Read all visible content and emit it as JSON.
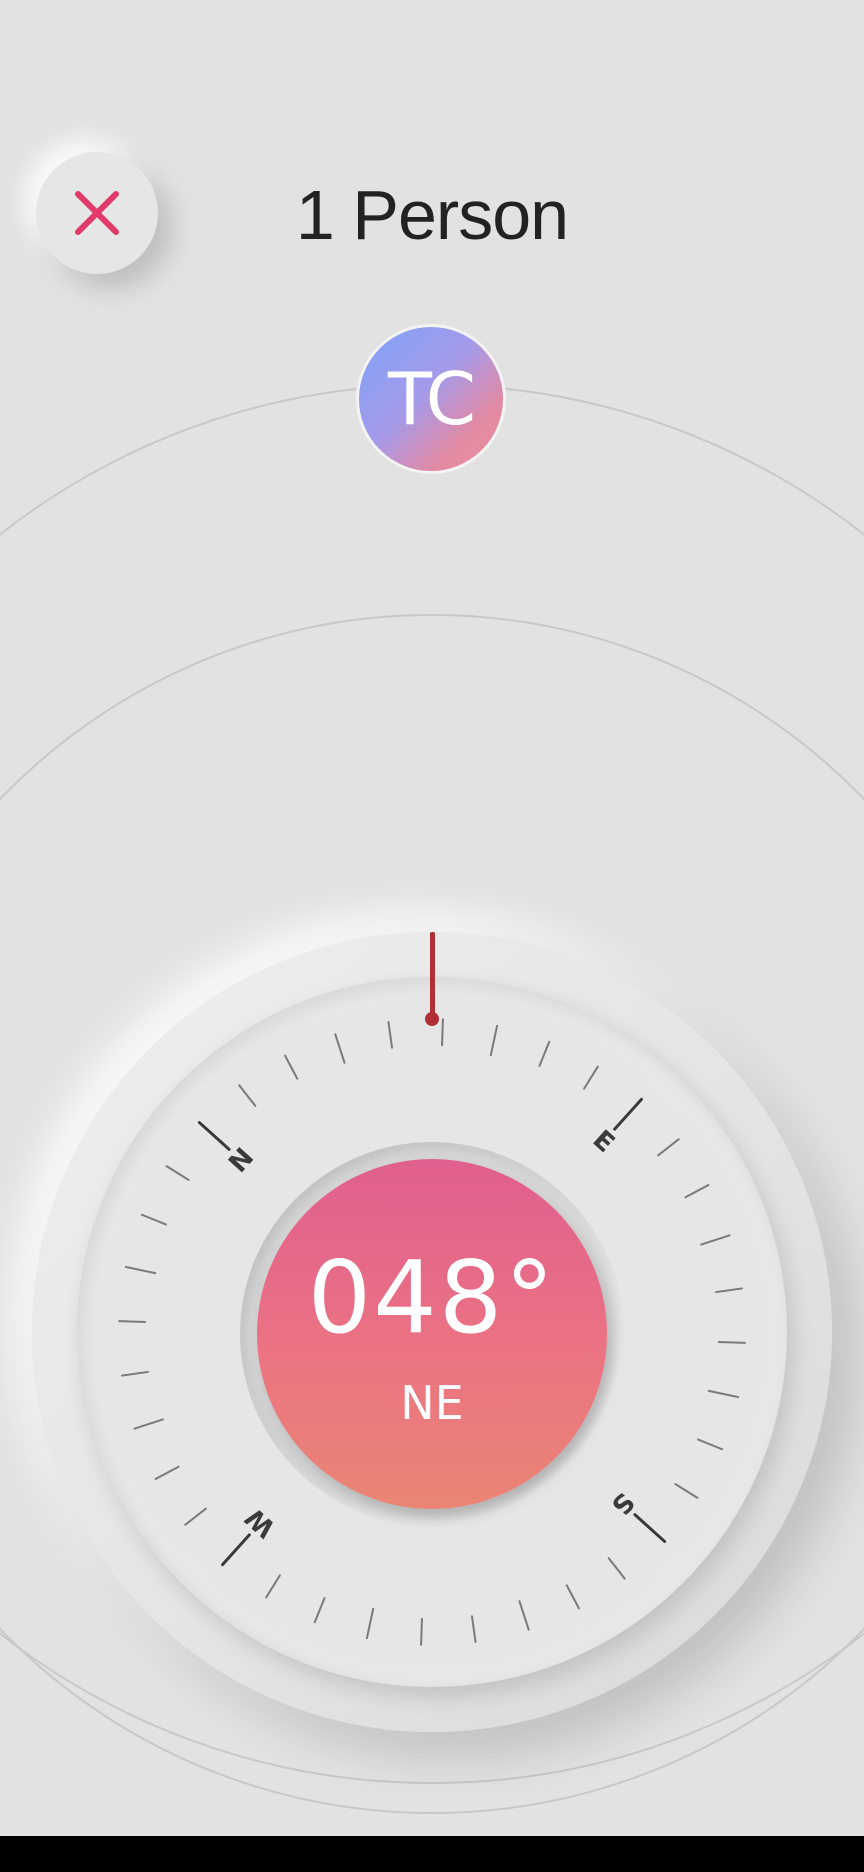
{
  "header": {
    "title": "1 Person",
    "close_icon": "close-icon",
    "close_color": "#e0396a"
  },
  "people": [
    {
      "initials": "TC"
    }
  ],
  "compass": {
    "heading_degrees": "048°",
    "heading_cardinal": "NE",
    "dial_rotation_deg": -48,
    "cardinal_labels": [
      "N",
      "E",
      "S",
      "W"
    ],
    "needle_color": "#b03035",
    "accent_gradient": [
      "#e05f8e",
      "#ea8573"
    ]
  }
}
